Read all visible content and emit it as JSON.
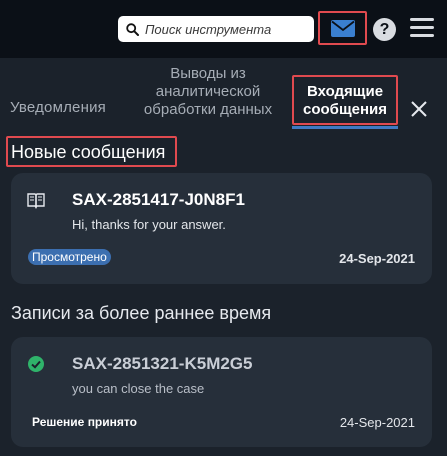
{
  "header": {
    "search_placeholder": "Поиск инструмента",
    "help_label": "?"
  },
  "tabs": {
    "notifications": "Уведомления",
    "analytics_line1": "Выводы из",
    "analytics_line2": "аналитической",
    "analytics_line3": "обработки данных",
    "inbox_line1": "Входящие",
    "inbox_line2": "сообщения"
  },
  "sections": {
    "new_messages": "Новые сообщения",
    "earlier": "Записи за более раннее время"
  },
  "messages_new": [
    {
      "id": "SAX-2851417-J0N8F1",
      "preview": "Hi, thanks for your answer.",
      "badge": "Просмотрено",
      "date": "24-Sep-2021",
      "icon": "book-icon"
    }
  ],
  "messages_earlier": [
    {
      "id": "SAX-2851321-K5M2G5",
      "preview": "you can close the case",
      "status": "Решение принято",
      "date": "24-Sep-2021",
      "icon": "check-circle-icon"
    }
  ],
  "colors": {
    "highlight": "#e04a4f",
    "accent": "#3f7ac4",
    "success": "#2fb36a"
  }
}
